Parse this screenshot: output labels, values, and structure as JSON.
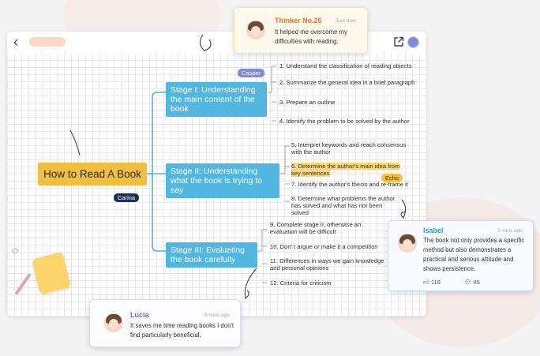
{
  "mindmap": {
    "central": "How to Read A Book",
    "stages": [
      {
        "label": "Stage I: Understanding the main content of the book"
      },
      {
        "label": "Stage II: Understanding what the book is trying to say"
      },
      {
        "label": "Stage III: Evaluating the book carefully"
      }
    ],
    "leaves": [
      "1. Understand the classification of reading objects",
      "2. Summarize the general idea in a brief paragraph",
      "3. Prepare an outline",
      "4. Identify the problem to be solved by the author",
      "5. Interpret keywords and reach consensus with the author",
      "6. Determine the author's main idea from key sentences",
      "7. Identify the author's thesis and re-frame it",
      "8. Determine what problems the author has solved and what has not been solved",
      "9. Complete stage II, otherwise an evaluation will be difficult",
      "10. Don' t argue or make it a competition",
      "11. Differences in ways we gain knowledge and personal opinions",
      "12. Criteria for criticism"
    ]
  },
  "collaborators": {
    "casper": "Casper",
    "carina": "Carina",
    "echo": "Echo"
  },
  "comments": {
    "thinker": {
      "name": "Thinker No.26",
      "time": "Just now",
      "text": "It helped me overcome my difficulties with reading.",
      "name_color": "#e8733a"
    },
    "isabel": {
      "name": "Isabel",
      "time": "2 mins ago",
      "text": "The book not only provides a specific method but also demonstrates a practical and serious attitude and shows persistence.",
      "likes": "118",
      "replies": "85",
      "name_color": "#2e9bd3"
    },
    "lucia": {
      "name": "Lucia",
      "time": "5 mins ago",
      "text": "It saves me time reading books I don't find particularly beneficial.",
      "name_color": "#7a5cc9"
    }
  },
  "icons": [
    "back-icon",
    "share-icon",
    "like-icon",
    "comment-icon"
  ],
  "colors": {
    "central": "#f1bf3f",
    "stage": "#52b7e0",
    "connector": "#55b6de"
  }
}
